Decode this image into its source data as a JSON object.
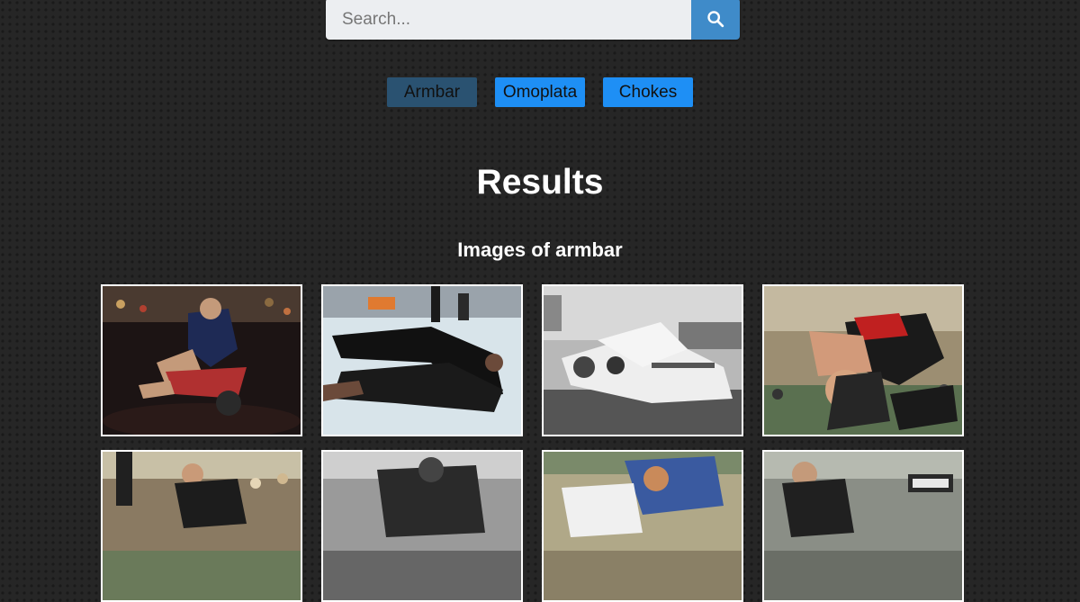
{
  "search": {
    "placeholder": "Search...",
    "value": "",
    "button_icon": "search-icon"
  },
  "tags": [
    {
      "label": "Armbar",
      "active": true
    },
    {
      "label": "Omoplata",
      "active": false
    },
    {
      "label": "Chokes",
      "active": false
    }
  ],
  "results": {
    "title": "Results",
    "subtitle": "Images of armbar"
  },
  "images": [
    {
      "description": "Wrestling match, athlete in red and blue singlets on mat"
    },
    {
      "description": "Grappler in black rash guard applying armbar on white mat"
    },
    {
      "description": "Black and white photo of gi grapplers on mat"
    },
    {
      "description": "No-gi grapplers in red and black rash guards"
    },
    {
      "description": "Grapplers in action in front of crowd"
    },
    {
      "description": "Black and white photo of grapplers in gi"
    },
    {
      "description": "Gi grapplers, one in blue gi"
    },
    {
      "description": "No-gi grappler at competition"
    }
  ],
  "colors": {
    "accent": "#1e8ff5",
    "active_tag": "#2a5271",
    "search_button": "#3f8bc9",
    "background": "#262626"
  }
}
